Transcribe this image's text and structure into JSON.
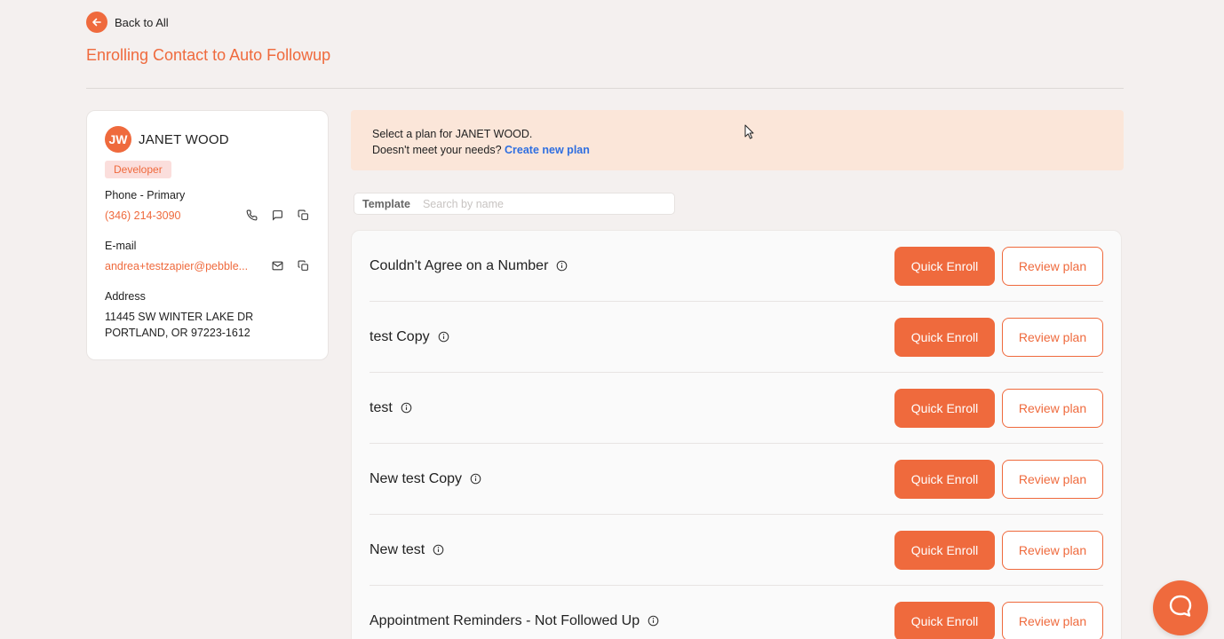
{
  "back": {
    "label": "Back to All"
  },
  "page": {
    "title": "Enrolling Contact to Auto Followup"
  },
  "contact": {
    "initials": "JW",
    "name": "JANET WOOD",
    "role": "Developer",
    "phone_label": "Phone - Primary",
    "phone": "(346) 214-3090",
    "email_label": "E-mail",
    "email": "andrea+testzapier@pebble...",
    "address_label": "Address",
    "address_line1": "11445 SW WINTER LAKE DR",
    "address_line2": "PORTLAND, OR 97223-1612"
  },
  "banner": {
    "line1": "Select a plan for JANET WOOD.",
    "line2_prefix": "Doesn't meet your needs?",
    "create_link": "Create new plan"
  },
  "search": {
    "label": "Template",
    "placeholder": "Search by name"
  },
  "plans": [
    {
      "name": "Couldn't Agree on a Number",
      "enroll_label": "Quick Enroll",
      "review_label": "Review plan"
    },
    {
      "name": "test Copy",
      "enroll_label": "Quick Enroll",
      "review_label": "Review plan"
    },
    {
      "name": "test",
      "enroll_label": "Quick Enroll",
      "review_label": "Review plan"
    },
    {
      "name": "New test Copy",
      "enroll_label": "Quick Enroll",
      "review_label": "Review plan"
    },
    {
      "name": "New test",
      "enroll_label": "Quick Enroll",
      "review_label": "Review plan"
    },
    {
      "name": "Appointment Reminders - Not Followed Up",
      "enroll_label": "Quick Enroll",
      "review_label": "Review plan"
    }
  ],
  "colors": {
    "accent": "#ef6a3d",
    "link": "#2f6fe0",
    "banner_bg": "#fbe6d9",
    "background": "#f4f0ef"
  },
  "icons": [
    "arrow-left-icon",
    "phone-icon",
    "message-icon",
    "copy-icon",
    "mail-icon",
    "info-icon",
    "chat-help-icon",
    "mouse-cursor-icon"
  ]
}
